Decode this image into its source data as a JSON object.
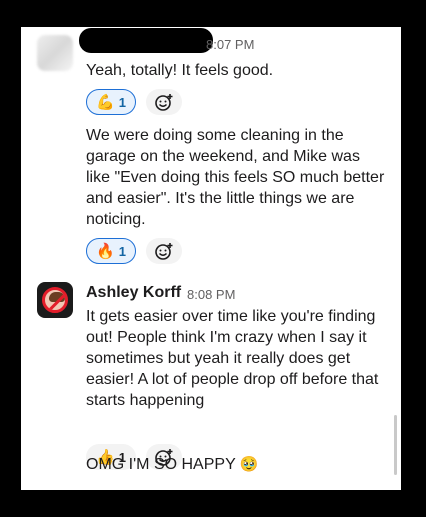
{
  "messages": [
    {
      "timestamp": "8:07 PM",
      "text": "Yeah, totally! It feels good.",
      "reaction": {
        "emoji": "💪",
        "count": "1"
      }
    },
    {
      "text": "We were doing some cleaning in the garage on the weekend, and Mike was like \"Even doing this feels SO much better and easier\". It's the little things we are noticing.",
      "reaction": {
        "emoji": "🔥",
        "count": "1"
      }
    },
    {
      "author": "Ashley Korff",
      "timestamp": "8:08 PM",
      "text": "It gets easier over time like you're finding out! People think I'm crazy when I say it sometimes but yeah it really does get easier! A lot of people drop off before that starts happening",
      "reaction": {
        "emoji": "👍",
        "count": "1"
      }
    },
    {
      "text": "OMG I'M SO HAPPY",
      "emoji": "🥹"
    }
  ],
  "icons": {
    "add_reaction": "add-reaction-icon"
  },
  "colors": {
    "active_reaction_border": "#1d6fd6",
    "active_reaction_bg": "#e8f2fd",
    "text": "#1d1c1d",
    "timestamp": "#616061"
  }
}
